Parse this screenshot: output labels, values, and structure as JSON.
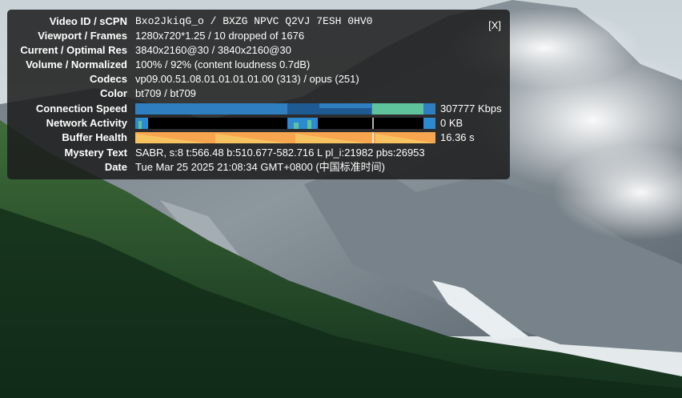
{
  "close_label": "[X]",
  "stats": [
    {
      "label": "Video ID / sCPN",
      "value": "Bxo2JkiqG_o / BXZG NPVC Q2VJ 7ESH 0HV0"
    },
    {
      "label": "Viewport / Frames",
      "value": "1280x720*1.25 / 10 dropped of 1676"
    },
    {
      "label": "Current / Optimal Res",
      "value": "3840x2160@30 / 3840x2160@30"
    },
    {
      "label": "Volume / Normalized",
      "value": "100% / 92% (content loudness 0.7dB)"
    },
    {
      "label": "Codecs",
      "value": "vp09.00.51.08.01.01.01.01.00 (313) / opus (251)"
    },
    {
      "label": "Color",
      "value": "bt709 / bt709"
    },
    {
      "label": "Connection Speed",
      "value": "307777 Kbps"
    },
    {
      "label": "Network Activity",
      "value": "0 KB"
    },
    {
      "label": "Buffer Health",
      "value": "16.36 s"
    },
    {
      "label": "Mystery Text",
      "value": "SABR, s:8 t:566.48 b:510.677-582.716 L pl_i:21982 pbs:26953"
    },
    {
      "label": "Date",
      "value": "Tue Mar 25 2025 21:08:34 GMT+0800 (中国标准时间)"
    }
  ],
  "colors": {
    "panel_bg": "#1c1c1c",
    "connection_bar": "#2e7ec0",
    "connection_bar_dark": "#1f5a93",
    "connection_bar_green": "#5ec39a",
    "network_bar": "#000000",
    "network_burst": "#2b8ad0",
    "buffer_bar": "#f7a64f",
    "buffer_stripe": "#f6d06a"
  }
}
